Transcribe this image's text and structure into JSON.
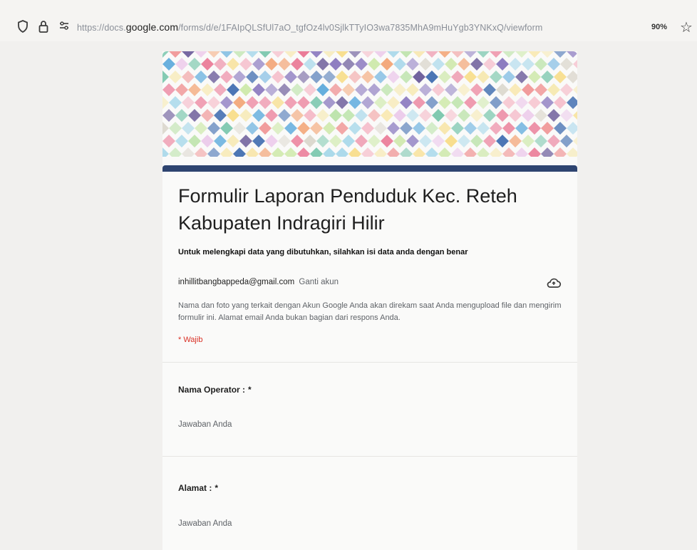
{
  "browser": {
    "url_prefix": "https://docs.",
    "url_host": "google.com",
    "url_path": "/forms/d/e/1FAIpQLSfUl7aO_tgfOz4lv0SjlkTTyIO3wa7835MhA9mHuYgb3YNKxQ/viewform",
    "zoom": "90%"
  },
  "form": {
    "title": "Formulir Laporan Penduduk Kec. Reteh Kabupaten Indragiri Hilir",
    "description": "Untuk melengkapi data yang dibutuhkan, silahkan isi data anda dengan benar",
    "account_email": "inhillitbangbappeda@gmail.com",
    "switch_account": "Ganti akun",
    "notice": "Nama dan foto yang terkait dengan Akun Google Anda akan direkam saat Anda mengupload file dan mengirim formulir ini. Alamat email Anda bukan bagian dari respons Anda.",
    "required_note": "* Wajib",
    "accent_color": "#2e4470"
  },
  "questions": [
    {
      "label": "Nama Operator :",
      "required_mark": "*",
      "placeholder": "Jawaban Anda"
    },
    {
      "label": "Alamat :",
      "required_mark": "*",
      "placeholder": "Jawaban Anda"
    }
  ]
}
